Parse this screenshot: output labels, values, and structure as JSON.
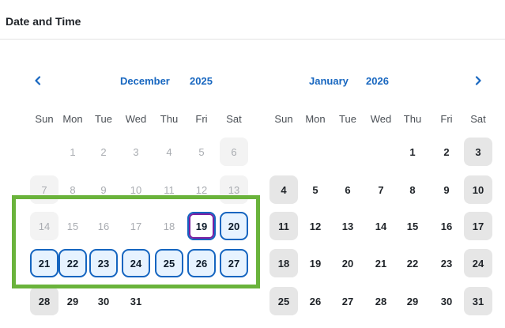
{
  "dialog": {
    "title": "Date and Time"
  },
  "nav": {
    "prev_icon": "chevron-left-icon",
    "next_icon": "chevron-right-icon"
  },
  "calendars": [
    {
      "month": "December",
      "year": "2025",
      "weekdays": [
        "Sun",
        "Mon",
        "Tue",
        "Wed",
        "Thu",
        "Fri",
        "Sat"
      ],
      "weeks": [
        [
          "",
          "1",
          "2",
          "3",
          "4",
          "5",
          "6"
        ],
        [
          "7",
          "8",
          "9",
          "10",
          "11",
          "12",
          "13"
        ],
        [
          "14",
          "15",
          "16",
          "17",
          "18",
          "19",
          "20"
        ],
        [
          "21",
          "22",
          "23",
          "24",
          "25",
          "26",
          "27"
        ],
        [
          "28",
          "29",
          "30",
          "31",
          "",
          "",
          ""
        ]
      ]
    },
    {
      "month": "January",
      "year": "2026",
      "weekdays": [
        "Sun",
        "Mon",
        "Tue",
        "Wed",
        "Thu",
        "Fri",
        "Sat"
      ],
      "weeks": [
        [
          "",
          "",
          "",
          "",
          "1",
          "2",
          "3"
        ],
        [
          "4",
          "5",
          "6",
          "7",
          "8",
          "9",
          "10"
        ],
        [
          "11",
          "12",
          "13",
          "14",
          "15",
          "16",
          "17"
        ],
        [
          "18",
          "19",
          "20",
          "21",
          "22",
          "23",
          "24"
        ],
        [
          "25",
          "26",
          "27",
          "28",
          "29",
          "30",
          "31"
        ]
      ]
    }
  ],
  "today": "December 19, 2025",
  "selected_range": [
    "December 19, 2025",
    "December 27, 2025"
  ],
  "colors": {
    "accent": "#1867c0",
    "selected_border": "#1565c0",
    "selected_fill": "#e7f3ff",
    "today_ring": "#7b1fa2",
    "highlight_box": "#6ab33b"
  }
}
